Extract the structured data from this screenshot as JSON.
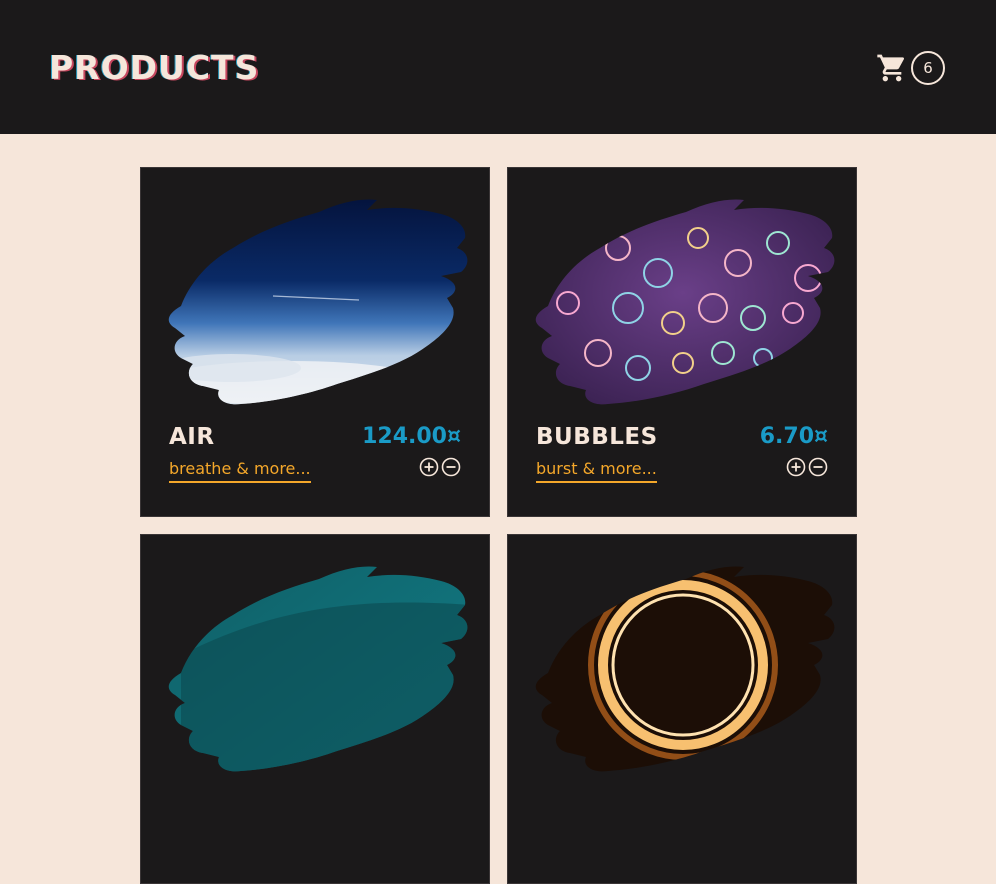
{
  "header": {
    "title": "PRODUCTS",
    "cart": {
      "icon": "cart-icon",
      "count": "6"
    }
  },
  "products": [
    {
      "name": "AIR",
      "price": "124.00¤",
      "link": "breathe & more...",
      "image": "night-sky-over-clouds"
    },
    {
      "name": "BUBBLES",
      "price": "6.70¤",
      "link": "burst & more...",
      "image": "soap-bubbles"
    },
    {
      "image": "teal-sparkle"
    },
    {
      "image": "glowing-light-ring"
    }
  ],
  "icons": {
    "add": "plus-circle-icon",
    "remove": "minus-circle-icon"
  },
  "colors": {
    "background": "#f6e6da",
    "header": "#1b191a",
    "price": "#1a9bc7",
    "link": "#f4a72a",
    "card": "#1b191a"
  }
}
